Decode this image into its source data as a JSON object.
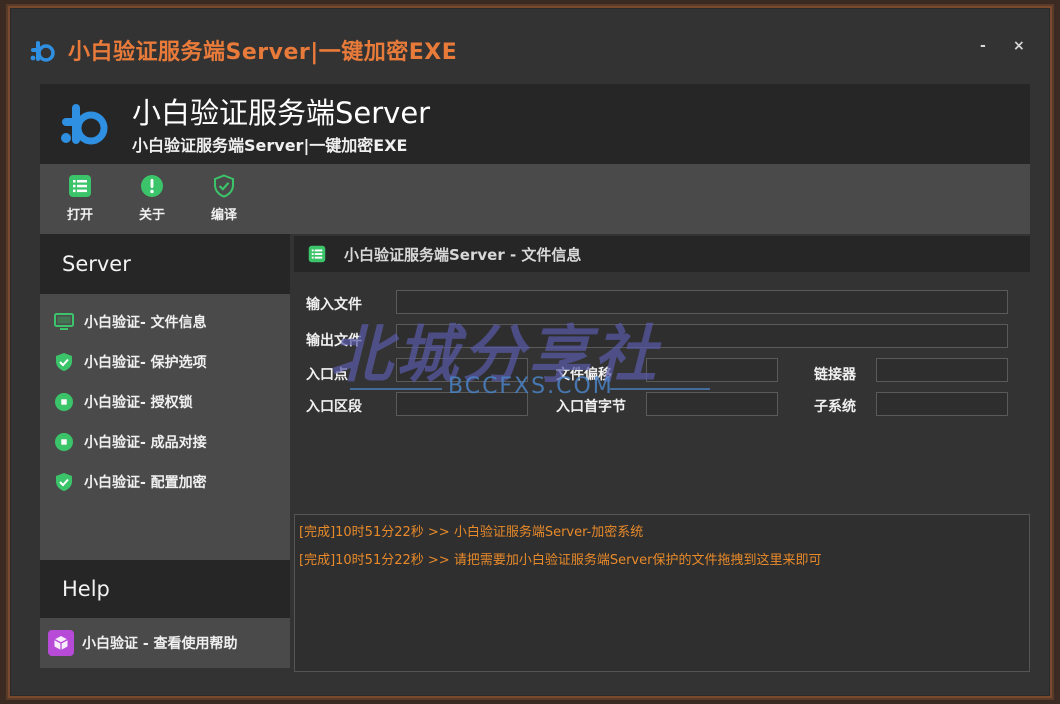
{
  "window": {
    "title": "小白验证服务端Server|一键加密EXE",
    "min_label": "-",
    "close_label": "×"
  },
  "header": {
    "title": "小白验证服务端Server",
    "subtitle": "小白验证服务端Server|一键加密EXE"
  },
  "toolbar": {
    "items": [
      {
        "label": "打开",
        "icon": "list-icon"
      },
      {
        "label": "关于",
        "icon": "info-icon"
      },
      {
        "label": "编译",
        "icon": "shield-icon"
      }
    ]
  },
  "sidebar": {
    "server_title": "Server",
    "items": [
      {
        "label": "小白验证- 文件信息",
        "icon": "monitor-icon"
      },
      {
        "label": "小白验证- 保护选项",
        "icon": "shield-check-icon"
      },
      {
        "label": "小白验证- 授权锁",
        "icon": "circle-dot-icon"
      },
      {
        "label": "小白验证- 成品对接",
        "icon": "circle-dot-icon"
      },
      {
        "label": "小白验证- 配置加密",
        "icon": "shield-check-icon"
      }
    ],
    "help_title": "Help",
    "help_item": "小白验证 - 查看使用帮助"
  },
  "panel": {
    "title": "小白验证服务端Server - 文件信息",
    "fields": {
      "input_file": {
        "label": "输入文件",
        "value": ""
      },
      "output_file": {
        "label": "输出文件",
        "value": ""
      },
      "entry_point": {
        "label": "入口点",
        "value": ""
      },
      "file_offset": {
        "label": "文件偏移",
        "value": ""
      },
      "linker": {
        "label": "链接器",
        "value": ""
      },
      "entry_section": {
        "label": "入口区段",
        "value": ""
      },
      "entry_first_byte": {
        "label": "入口首字节",
        "value": ""
      },
      "subsystem": {
        "label": "子系统",
        "value": ""
      }
    }
  },
  "watermark": {
    "text": "北城分享社",
    "sub": "BCCFXS.COM"
  },
  "log": [
    "[完成]10时51分22秒 >> 小白验证服务端Server-加密系统",
    "[完成]10时51分22秒 >> 请把需要加小白验证服务端Server保护的文件拖拽到这里来即可"
  ],
  "colors": {
    "accent": "#e87a3a",
    "icon_green": "#3cc46a",
    "log_text": "#e88a2a",
    "logo_blue": "#2f8fe0"
  }
}
